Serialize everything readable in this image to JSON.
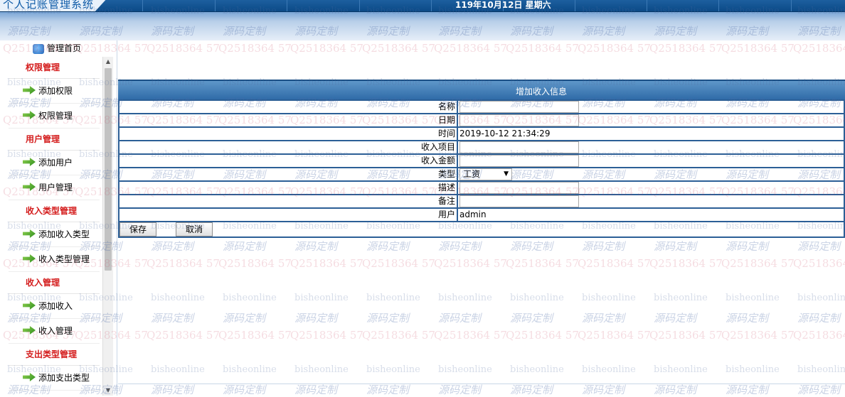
{
  "header": {
    "app_title": "个人记账管理系统",
    "date_text": "119年10月12日 星期六"
  },
  "watermarks": {
    "site": "bisheonline",
    "slogan": "源码定制",
    "qq": "Q2518364 57"
  },
  "sidebar": {
    "home_label": "管理首页",
    "groups": [
      {
        "title": "权限管理",
        "items": [
          "添加权限",
          "权限管理"
        ]
      },
      {
        "title": "用户管理",
        "items": [
          "添加用户",
          "用户管理"
        ]
      },
      {
        "title": "收入类型管理",
        "items": [
          "添加收入类型",
          "收入类型管理"
        ]
      },
      {
        "title": "收入管理",
        "items": [
          "添加收入",
          "收入管理"
        ]
      },
      {
        "title": "支出类型管理",
        "items": [
          "添加支出类型"
        ]
      }
    ]
  },
  "form": {
    "title": "增加收入信息",
    "fields": {
      "name": {
        "label": "名称",
        "value": ""
      },
      "date": {
        "label": "日期",
        "value": ""
      },
      "time": {
        "label": "时间",
        "value": "2019-10-12 21:34:29"
      },
      "item": {
        "label": "收入项目",
        "value": ""
      },
      "amount": {
        "label": "收入金额",
        "value": ""
      },
      "type": {
        "label": "类型",
        "value": "工资"
      },
      "desc": {
        "label": "描述",
        "value": ""
      },
      "note": {
        "label": "备注",
        "value": ""
      },
      "user": {
        "label": "用户",
        "value": "admin"
      }
    },
    "save_label": "保存",
    "cancel_label": "取消"
  }
}
